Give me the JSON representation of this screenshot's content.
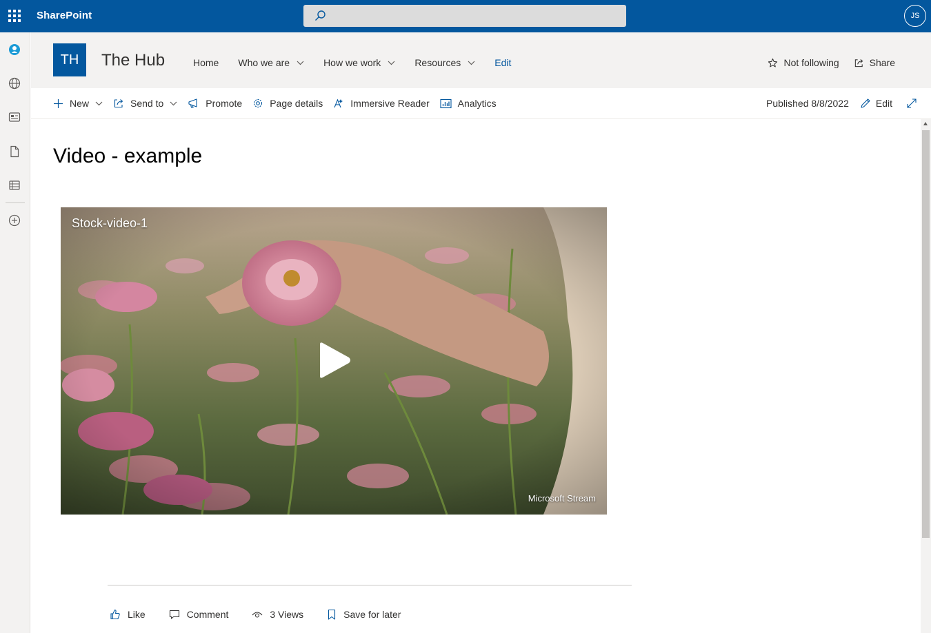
{
  "suite": {
    "app_name": "SharePoint",
    "avatar_initials": "JS"
  },
  "site": {
    "logo_initials": "TH",
    "title": "The Hub",
    "nav": [
      {
        "label": "Home"
      },
      {
        "label": "Who we are"
      },
      {
        "label": "How we work"
      },
      {
        "label": "Resources"
      },
      {
        "label": "Edit"
      }
    ],
    "not_following_label": "Not following",
    "share_label": "Share"
  },
  "command_bar": {
    "new_label": "New",
    "send_to_label": "Send to",
    "promote_label": "Promote",
    "page_details_label": "Page details",
    "immersive_reader_label": "Immersive Reader",
    "analytics_label": "Analytics",
    "published_label": "Published 8/8/2022",
    "edit_label": "Edit"
  },
  "page": {
    "title": "Video - example",
    "video": {
      "label": "Stock-video-1",
      "provider": "Microsoft Stream"
    }
  },
  "social": {
    "like_label": "Like",
    "comment_label": "Comment",
    "views_label": "3 Views",
    "save_label": "Save for later"
  },
  "colors": {
    "brand": "#03579e",
    "header_bg": "#f3f2f1"
  }
}
